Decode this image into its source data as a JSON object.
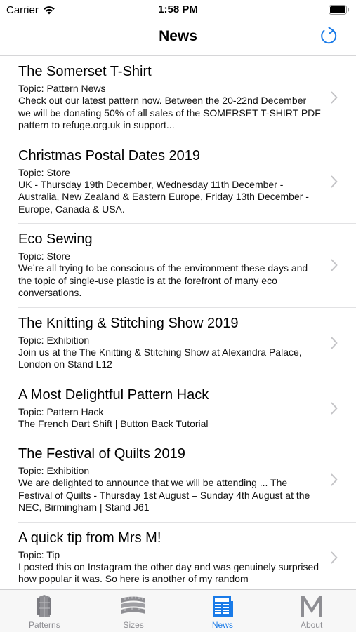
{
  "status_bar": {
    "carrier": "Carrier",
    "time": "1:58 PM"
  },
  "nav": {
    "title": "News",
    "refresh_icon": "refresh-icon"
  },
  "news": [
    {
      "title": "The Somerset T-Shirt",
      "topic": "Topic: Pattern News",
      "summary": "Check out our latest pattern now. Between the 20-22nd December we will be donating 50% of all sales of the SOMERSET T-SHIRT PDF pattern to refuge.org.uk in support..."
    },
    {
      "title": "Christmas Postal Dates 2019",
      "topic": "Topic: Store",
      "summary": "UK - Thursday 19th December, Wednesday 11th December - Australia, New Zealand & Eastern Europe, Friday 13th December - Europe, Canada & USA."
    },
    {
      "title": "Eco Sewing",
      "topic": "Topic: Store",
      "summary": "We’re all trying to be conscious of the environment these days and the topic of single-use plastic is at the forefront of many eco conversations."
    },
    {
      "title": "The Knitting & Stitching Show 2019",
      "topic": "Topic: Exhibition",
      "summary": "Join us at the The Knitting & Stitching Show at Alexandra Palace, London on Stand L12"
    },
    {
      "title": "A Most Delightful Pattern Hack",
      "topic": "Topic: Pattern Hack",
      "summary": "The French Dart Shift | Button Back Tutorial"
    },
    {
      "title": "The Festival of Quilts 2019",
      "topic": "Topic: Exhibition",
      "summary": "We are delighted to announce that we will be attending ... The Festival of Quilts - Thursday 1st August – Sunday 4th August at the NEC, Birmingham | Stand J61"
    },
    {
      "title": "A quick tip from Mrs M!",
      "topic": "Topic: Tip",
      "summary": "I posted this on Instagram the other day and was genuinely surprised how popular it was. So here is another of my random"
    }
  ],
  "tabs": [
    {
      "label": "Patterns",
      "icon": "patterns-icon",
      "active": false
    },
    {
      "label": "Sizes",
      "icon": "tape-measure-icon",
      "active": false
    },
    {
      "label": "News",
      "icon": "newspaper-icon",
      "active": true
    },
    {
      "label": "About",
      "icon": "m-logo-icon",
      "active": false
    }
  ],
  "colors": {
    "accent": "#1a7be8",
    "inactive": "#8e8e93"
  }
}
